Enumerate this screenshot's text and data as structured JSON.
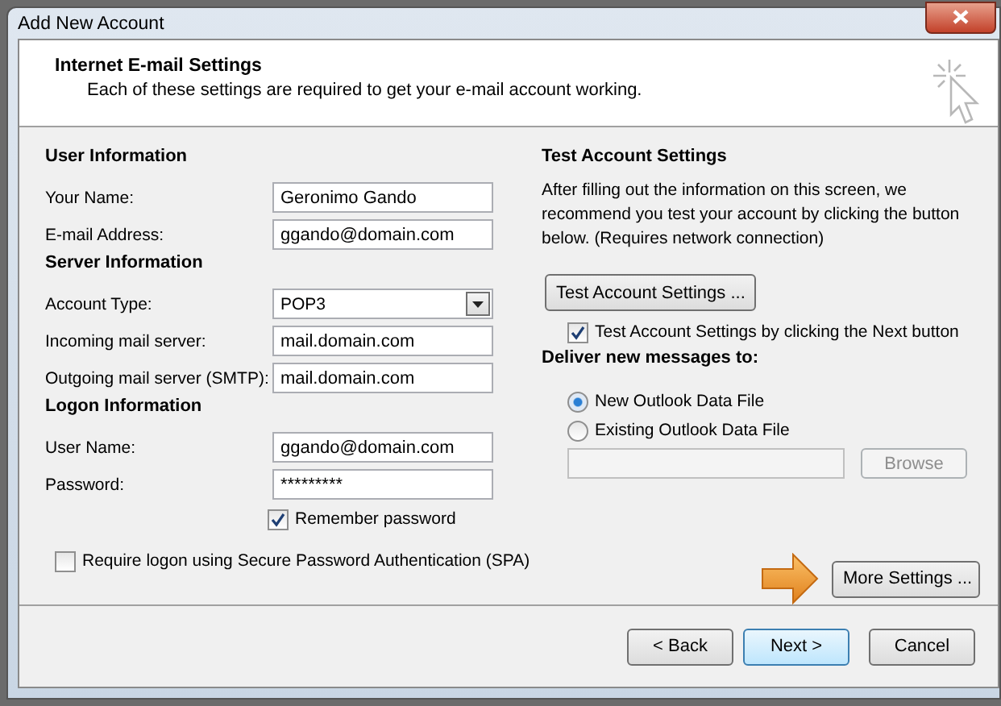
{
  "window": {
    "title": "Add New Account"
  },
  "header": {
    "title": "Internet E-mail Settings",
    "subtitle": "Each of these settings are required to get your e-mail account working."
  },
  "left": {
    "sections": [
      {
        "heading": "User Information",
        "fields": [
          {
            "label": "Your Name:",
            "kind": "text",
            "value": "Geronimo Gando"
          },
          {
            "label": "E-mail Address:",
            "kind": "text",
            "value": "ggando@domain.com"
          }
        ]
      },
      {
        "heading": "Server Information",
        "fields": [
          {
            "label": "Account Type:",
            "kind": "select",
            "value": "POP3"
          },
          {
            "label": "Incoming mail server:",
            "kind": "text",
            "value": "mail.domain.com"
          },
          {
            "label": "Outgoing mail server (SMTP):",
            "kind": "text",
            "value": "mail.domain.com"
          }
        ]
      },
      {
        "heading": "Logon Information",
        "fields": [
          {
            "label": "User Name:",
            "kind": "text",
            "value": "ggando@domain.com"
          },
          {
            "label": "Password:",
            "kind": "password",
            "value": "*********"
          }
        ]
      }
    ],
    "remember_password": {
      "label": "Remember password",
      "checked": true
    },
    "require_spa": {
      "label": "Require logon using Secure Password Authentication (SPA)",
      "checked": false
    }
  },
  "right": {
    "heading": "Test Account Settings",
    "description": "After filling out the information on this screen, we recommend you test your account by clicking the button below. (Requires network connection)",
    "test_button": "Test Account Settings ...",
    "test_on_next": {
      "label": "Test Account Settings by clicking the Next button",
      "checked": true
    },
    "deliver_heading": "Deliver new messages to:",
    "deliver_options": [
      {
        "label": "New Outlook Data File",
        "selected": true
      },
      {
        "label": "Existing Outlook Data File",
        "selected": false
      }
    ],
    "browse_button": {
      "label": "Browse",
      "disabled": true
    }
  },
  "more_settings_button": "More Settings ...",
  "footer_buttons": [
    {
      "label": "< Back",
      "kind": "normal"
    },
    {
      "label": "Next >",
      "kind": "default"
    },
    {
      "label": "Cancel",
      "kind": "normal"
    }
  ]
}
